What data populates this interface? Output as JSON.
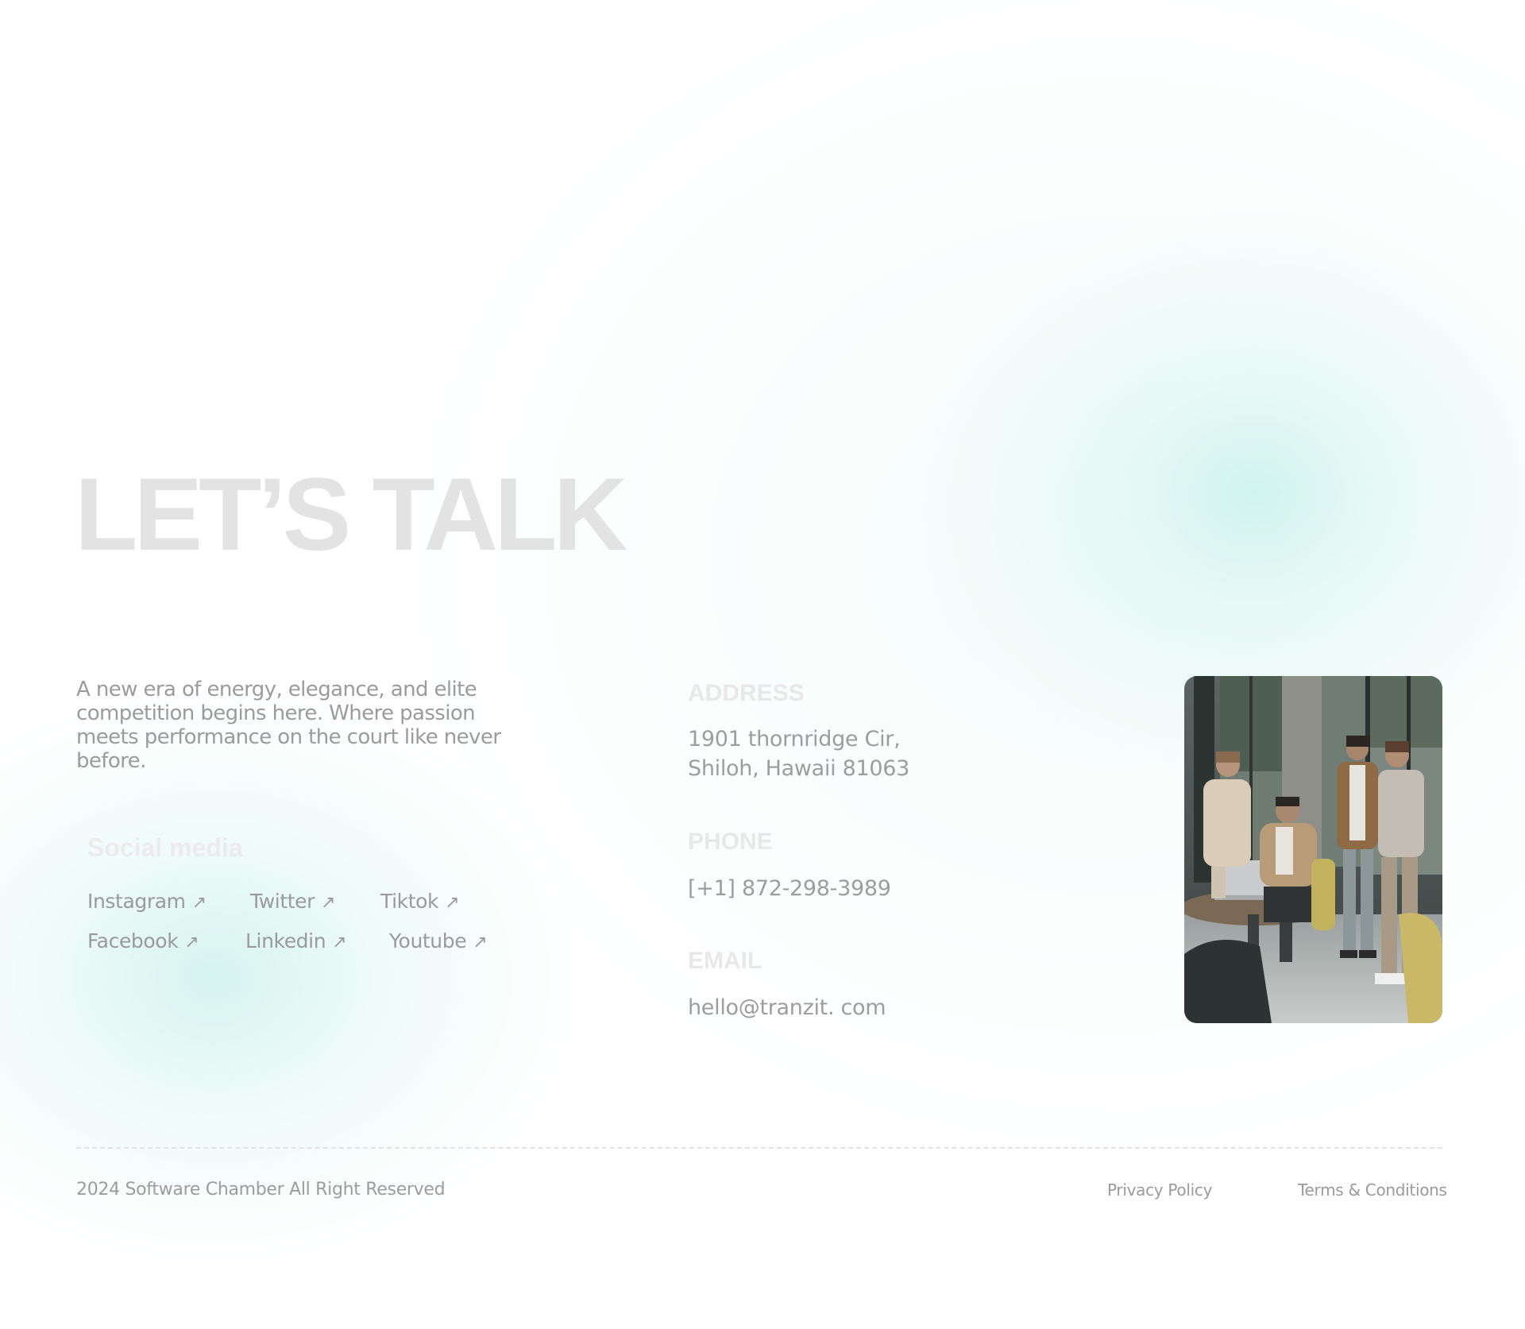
{
  "hero": {
    "title": "LET’S TALK"
  },
  "intro": {
    "text": "A new era of energy, elegance, and elite competition begins here. Where passion meets performance on the court like never before."
  },
  "social": {
    "title": "Social media",
    "arrow_icon": "arrow-up-right-icon",
    "links": [
      {
        "label": "Instagram"
      },
      {
        "label": "Twitter"
      },
      {
        "label": "Tiktok"
      },
      {
        "label": "Facebook"
      },
      {
        "label": "Linkedin"
      },
      {
        "label": "Youtube"
      }
    ]
  },
  "contact": {
    "address": {
      "label": "ADDRESS",
      "line1": "1901 thornridge Cir,",
      "line2": "Shiloh, Hawaii 81063"
    },
    "phone": {
      "label": "PHONE",
      "value": "[+1] 872-298-3989"
    },
    "email": {
      "label": "EMAIL",
      "value": "hello@tranzit. com"
    }
  },
  "footer": {
    "copyright": "2024 Software Chamber All Right Reserved",
    "privacy": "Privacy Policy",
    "terms": "Terms & Conditions"
  },
  "colors": {
    "accent_glow": "#c8f0ea",
    "heading_faint": "#e3e3e3",
    "text_gray": "#9b9b9b"
  }
}
